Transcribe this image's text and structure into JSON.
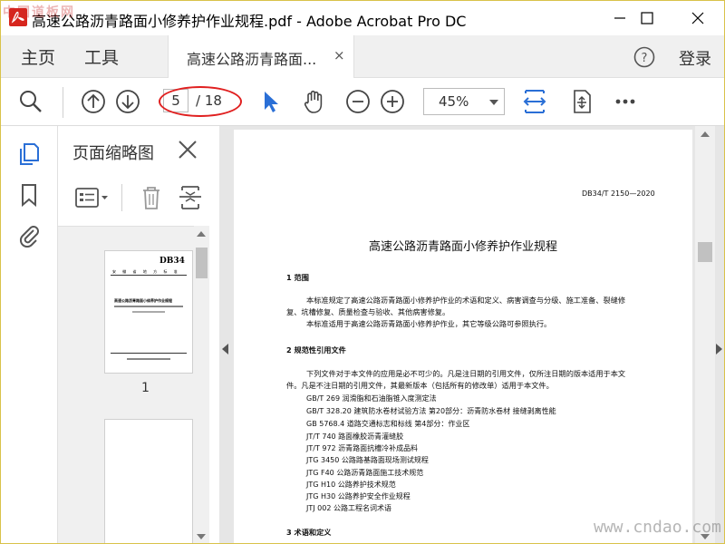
{
  "window": {
    "title": "高速公路沥青路面小修养护作业规程.pdf - Adobe Acrobat Pro DC",
    "minimize_icon": "minimize-icon",
    "maximize_icon": "maximize-icon",
    "close_icon": "close-icon"
  },
  "menubar": {
    "home": "主页",
    "tools": "工具",
    "tab_label": "高速公路沥青路面...",
    "tab_close": "×",
    "help_icon": "help-icon",
    "login": "登录"
  },
  "toolbar": {
    "page_current": "5",
    "page_total": "/ 18",
    "zoom": "45%",
    "icons": [
      "search-icon",
      "prev-page-icon",
      "next-page-icon",
      "select-cursor-icon",
      "hand-tool-icon",
      "zoom-out-icon",
      "zoom-in-icon",
      "fit-width-icon",
      "scroll-mode-icon",
      "more-icon"
    ],
    "highlight_color": "#e02020",
    "accent_color": "#2a6fd6"
  },
  "sidebar": {
    "panel_title": "页面缩略图",
    "thumbnail_label": "1",
    "thumb_text": {
      "code": "DB34",
      "org_line": "安 徽 省 地 方 标 准",
      "title_line": "高速公路沥青路面小修养护作业规程"
    }
  },
  "document": {
    "code": "DB34/T 2150—2020",
    "title": "高速公路沥青路面小修养护作业规程",
    "section1_heading": "1   范围",
    "section1_para1a": "本标准规定了高速公路沥青路面小修养护作业的术语和定义、病害调查与分级、施工准备、裂缝修",
    "section1_para1b": "复、坑槽修复、质量检查与验收、其他病害修复。",
    "section1_para2": "本标准适用于高速公路沥青路面小修养护作业，其它等级公路可参照执行。",
    "section2_heading": "2   规范性引用文件",
    "section2_para_a": "下列文件对于本文件的应用是必不可少的。凡是注日期的引用文件，仅所注日期的版本适用于本文",
    "section2_para_b": "件。凡是不注日期的引用文件，其最新版本（包括所有的修改单）适用于本文件。",
    "references": [
      "GB/T 269   润滑脂和石油脂锥入度测定法",
      "GB/T 328.20   建筑防水卷材试验方法 第20部分：沥青防水卷材 接缝剥离性能",
      "GB 5768.4   道路交通标志和标线 第4部分：作业区",
      "JT/T 740   路面橡胶沥青灌缝胶",
      "JT/T 972   沥青路面抗槽冷补成品料",
      "JTG 3450   公路路基路面现场测试规程",
      "JTG F40   公路沥青路面施工技术规范",
      "JTG H10   公路养护技术规范",
      "JTG H30   公路养护安全作业规程",
      "JTJ 002   公路工程名词术语"
    ],
    "section3_heading": "3   术语和定义"
  },
  "watermarks": {
    "top_left": "中国道板网",
    "bottom_right": "www.cndao.com"
  }
}
